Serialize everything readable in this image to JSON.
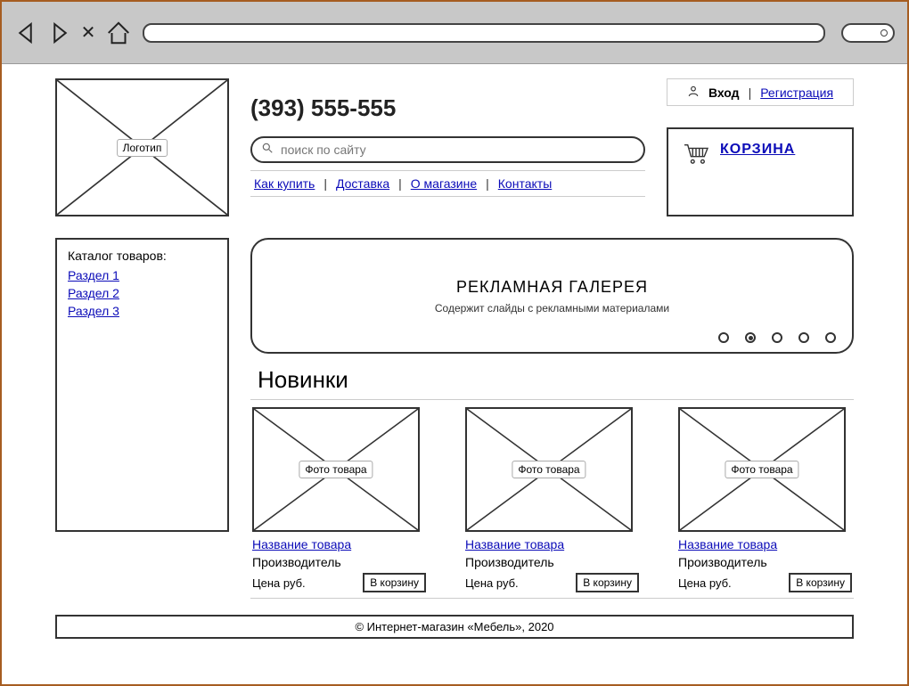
{
  "header": {
    "logo_label": "Логотип",
    "phone": "(393) 555-555",
    "search_placeholder": "поиск по сайту",
    "nav": [
      "Как купить",
      "Доставка",
      "О магазине",
      "Контакты"
    ]
  },
  "auth": {
    "login": "Вход",
    "register": "Регистрация"
  },
  "cart": {
    "label": "КОРЗИНА"
  },
  "catalog": {
    "title": "Каталог товаров:",
    "items": [
      "Раздел 1",
      "Раздел 2",
      "Раздел 3"
    ]
  },
  "gallery": {
    "title": "РЕКЛАМНАЯ ГАЛЕРЕЯ",
    "desc": "Содержит слайды с рекламными материалами",
    "dots": 5,
    "active_dot": 1
  },
  "section_title": "Новинки",
  "products": [
    {
      "photo_label": "Фото товара",
      "name": "Название товара",
      "manufacturer": "Производитель",
      "price": "Цена руб.",
      "button": "В корзину"
    },
    {
      "photo_label": "Фото товара",
      "name": "Название товара",
      "manufacturer": "Производитель",
      "price": "Цена руб.",
      "button": "В корзину"
    },
    {
      "photo_label": "Фото товара",
      "name": "Название товара",
      "manufacturer": "Производитель",
      "price": "Цена руб.",
      "button": "В корзину"
    }
  ],
  "footer": "© Интернет-магазин «Мебель», 2020"
}
